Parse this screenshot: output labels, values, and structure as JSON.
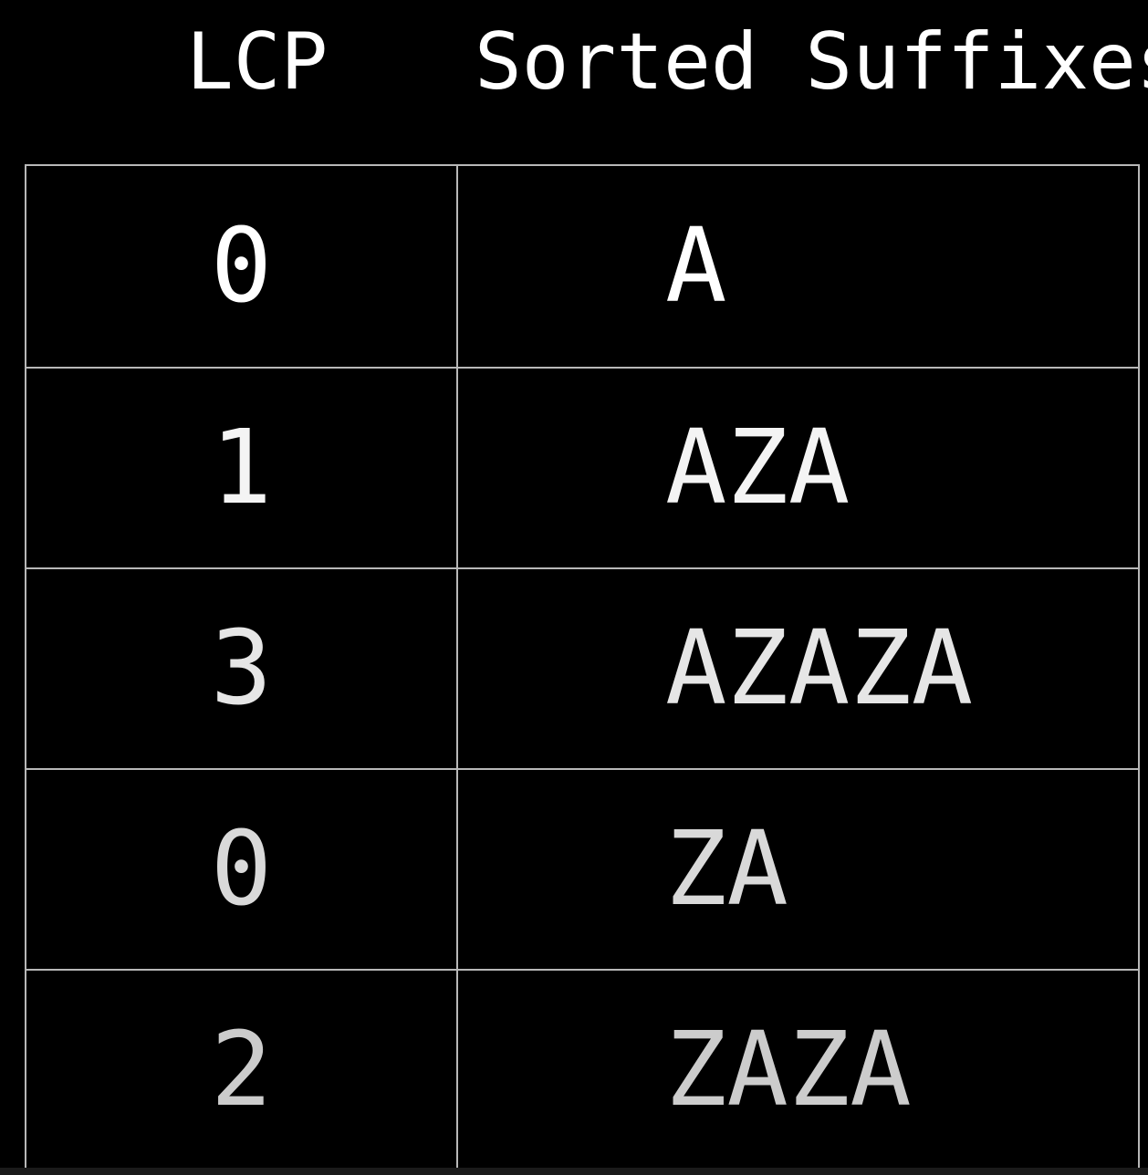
{
  "headers": {
    "lcp": "LCP",
    "suffixes": "Sorted Suffixes"
  },
  "rows": [
    {
      "lcp": "0",
      "suffix": "A",
      "color": "#ffffff"
    },
    {
      "lcp": "1",
      "suffix": "AZA",
      "color": "#f4f4f4"
    },
    {
      "lcp": "3",
      "suffix": "AZAZA",
      "color": "#e6e6e6"
    },
    {
      "lcp": "0",
      "suffix": "ZA",
      "color": "#d9d9d9"
    },
    {
      "lcp": "2",
      "suffix": "ZAZA",
      "color": "#cccccc"
    }
  ]
}
